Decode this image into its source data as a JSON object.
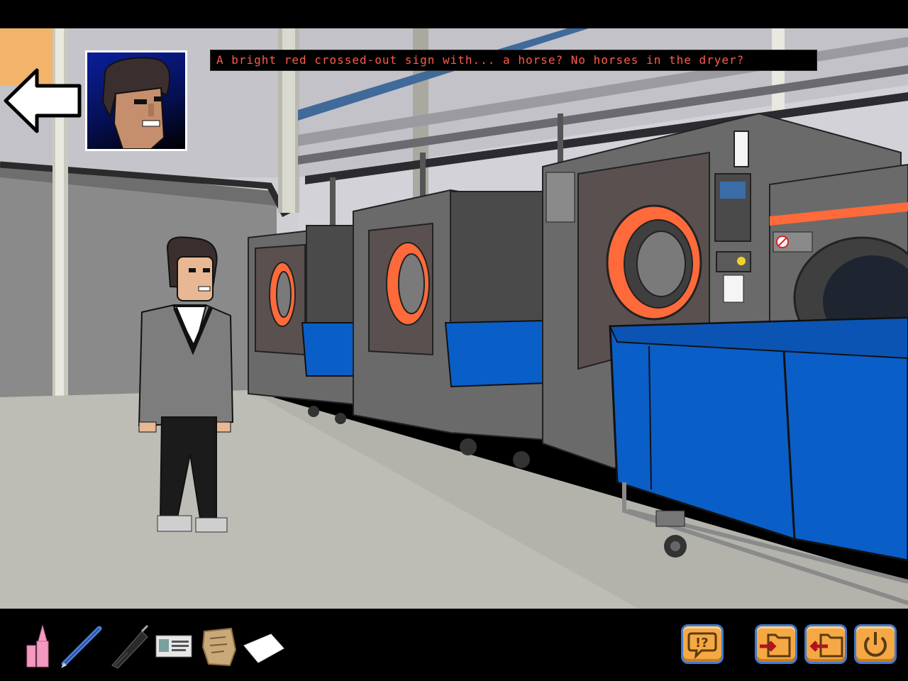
{
  "dialogue": {
    "text": "A bright red crossed-out sign with... a horse? No horses in the dryer?"
  },
  "scene": {
    "name": "Laundromat"
  },
  "navigation": {
    "back_icon": "left-arrow-icon"
  },
  "portrait": {
    "character": "protagonist-portrait"
  },
  "inventory": {
    "items": [
      {
        "name": "lipstick",
        "icon": "lipstick-icon"
      },
      {
        "name": "pen",
        "icon": "pen-icon"
      },
      {
        "name": "umbrella",
        "icon": "umbrella-icon"
      },
      {
        "name": "id-card",
        "icon": "id-card-icon"
      },
      {
        "name": "old-map",
        "icon": "parchment-icon"
      },
      {
        "name": "paper",
        "icon": "paper-icon"
      }
    ]
  },
  "controls": {
    "hint_icon": "hint-icon",
    "load_icon": "load-folder-icon",
    "save_icon": "save-folder-icon",
    "quit_icon": "power-icon",
    "button_color": "#f5a843",
    "button_border": "#3f7ad0"
  },
  "colors": {
    "dialogue_text": "#ff5b4a",
    "cart_blue": "#0a5ec7",
    "machine_grey": "#6a6a6a",
    "door_orange": "#ff6a3a"
  }
}
